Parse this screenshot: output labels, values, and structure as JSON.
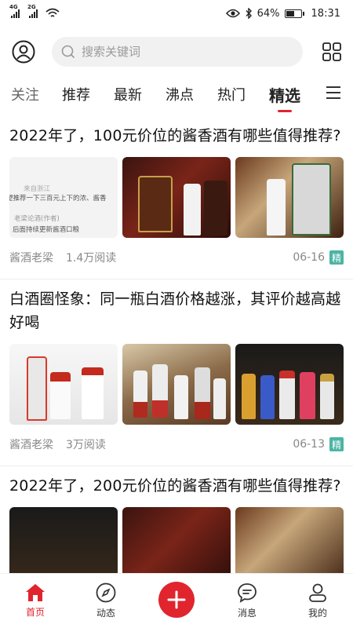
{
  "status_bar": {
    "network_1": "4G",
    "network_2": "2G",
    "battery_percent": "64%",
    "battery_level": 0.64,
    "time": "18:31"
  },
  "header": {
    "search_placeholder": "搜索关键词"
  },
  "tabs": [
    {
      "label": "关注"
    },
    {
      "label": "推荐"
    },
    {
      "label": "最新"
    },
    {
      "label": "沸点"
    },
    {
      "label": "热门"
    },
    {
      "label": "精选"
    }
  ],
  "articles": [
    {
      "title": "2022年了，100元价位的酱香酒有哪些值得推荐?",
      "thumb_text": {
        "source": "来自浙江",
        "question": "望推荐一下三百元上下的浓、酱香",
        "answerer": "老梁论酒(作者)",
        "reply": "后面持续更新酱酒口粮"
      },
      "author": "酱酒老梁",
      "reads": "1.4万阅读",
      "date": "06-16",
      "badge": "精"
    },
    {
      "title": "白酒圈怪象：同一瓶白酒价格越涨，其评价越高越好喝",
      "author": "酱酒老梁",
      "reads": "3万阅读",
      "date": "06-13",
      "badge": "精"
    },
    {
      "title": "2022年了，200元价位的酱香酒有哪些值得推荐?"
    }
  ],
  "bottom_nav": {
    "home": "首页",
    "feed": "动态",
    "messages": "消息",
    "mine": "我的"
  },
  "colors": {
    "accent": "#e0252e",
    "badge": "#4bb4a4"
  }
}
